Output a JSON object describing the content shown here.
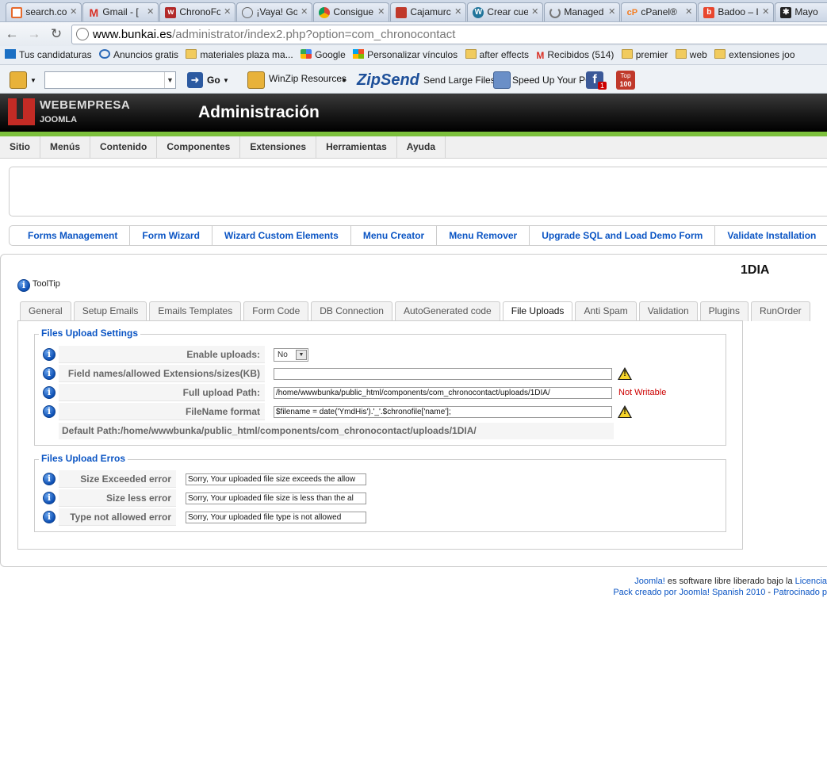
{
  "browser": {
    "tabs": [
      {
        "label": "search.co",
        "favicon": "search-favicon",
        "color": "#e66a2c"
      },
      {
        "label": "Gmail - [",
        "favicon": "gmail-favicon",
        "color": "#d93025"
      },
      {
        "label": "ChronoFo",
        "favicon": "chronoforms-favicon",
        "color": "#b22a2a"
      },
      {
        "label": "¡Vaya! Go",
        "favicon": "globe-favicon",
        "color": "#777777"
      },
      {
        "label": "Consigue",
        "favicon": "chrome-favicon",
        "color": "#2a8c3c"
      },
      {
        "label": "Cajamurc",
        "favicon": "pdf-favicon",
        "color": "#c0392b"
      },
      {
        "label": "Crear cue",
        "favicon": "wordpress-favicon",
        "color": "#21759b"
      },
      {
        "label": "Managed",
        "favicon": "loading-favicon",
        "color": "#888888"
      },
      {
        "label": "cPanel®",
        "favicon": "cpanel-favicon",
        "color": "#f47c20"
      },
      {
        "label": "Badoo – I",
        "favicon": "badoo-favicon",
        "color": "#e8462e"
      },
      {
        "label": "Mayo",
        "favicon": "joomla-favicon",
        "color": "#222222"
      }
    ],
    "url_host": "www.bunkai.es",
    "url_path": "/administrator/index2.php?option=com_chronocontact",
    "bookmarks": [
      {
        "label": "Tus candidaturas",
        "icon": "infojobs-icon"
      },
      {
        "label": "Anuncios gratis",
        "icon": "anuncios-icon"
      },
      {
        "label": "materiales plaza ma...",
        "icon": "folder-icon"
      },
      {
        "label": "Google",
        "icon": "google-icon"
      },
      {
        "label": "Personalizar vínculos",
        "icon": "windows-icon"
      },
      {
        "label": "after effects",
        "icon": "folder-icon"
      },
      {
        "label": "Recibidos (514)",
        "icon": "gmail-icon"
      },
      {
        "label": "premier",
        "icon": "folder-icon"
      },
      {
        "label": "web",
        "icon": "folder-icon"
      },
      {
        "label": "extensiones joo",
        "icon": "folder-icon"
      }
    ],
    "toolbar": {
      "go_label": "Go",
      "winzip_label": "WinZip Resources",
      "zipsend_label": "ZipSend",
      "send_large_label": "Send Large Files",
      "speedup_label": "Speed Up Your PC",
      "fb_badge": "1",
      "top_label": "Top",
      "top_num": "100"
    }
  },
  "header": {
    "brand": "WEBEMPRESA",
    "brand_sub": "JOOMLA",
    "title": "Administración"
  },
  "menu": [
    "Sitio",
    "Menús",
    "Contenido",
    "Componentes",
    "Extensiones",
    "Herramientas",
    "Ayuda"
  ],
  "submenu": [
    "Forms Management",
    "Form Wizard",
    "Wizard Custom Elements",
    "Menu Creator",
    "Menu Remover",
    "Upgrade SQL and Load Demo Form",
    "Validate Installation"
  ],
  "form_name": "1DIA",
  "tooltip_label": "ToolTip",
  "tabs": [
    "General",
    "Setup Emails",
    "Emails Templates",
    "Form Code",
    "DB Connection",
    "AutoGenerated code",
    "File Uploads",
    "Anti Spam",
    "Validation",
    "Plugins",
    "RunOrder"
  ],
  "active_tab": "File Uploads",
  "upload_settings": {
    "legend": "Files Upload Settings",
    "enable_label": "Enable uploads:",
    "enable_value": "No",
    "fields_label": "Field names/allowed Extensions/sizes(KB)",
    "fields_value": "",
    "path_label": "Full upload Path:",
    "path_value": "/home/wwwbunka/public_html/components/com_chronocontact/uploads/1DIA/",
    "path_status": "Not Writable",
    "filename_label": "FileName format",
    "filename_value": "$filename = date('YmdHis').'_'.$chronofile['name'];",
    "default_path": "Default Path:/home/wwwbunka/public_html/components/com_chronocontact/uploads/1DIA/"
  },
  "upload_errors": {
    "legend": "Files Upload Erros",
    "size_exceeded_label": "Size Exceeded error",
    "size_exceeded_value": "Sorry, Your uploaded file size exceeds the allow",
    "size_less_label": "Size less error",
    "size_less_value": "Sorry, Your uploaded file size is less than the al",
    "type_label": "Type not allowed error",
    "type_value": "Sorry, Your uploaded file type is not allowed"
  },
  "footer": {
    "joomla_link": "Joomla!",
    "line1_text": " es software libre liberado bajo la ",
    "licencia_link": "Licencia",
    "pack_link": "Pack creado por Joomla! Spanish 2010",
    "sep": " - ",
    "patro_link": "Patrocinado p"
  },
  "colors": {
    "accent_green": "#7cc03c",
    "link_blue": "#0b55c4",
    "error_red": "#cc0000"
  }
}
